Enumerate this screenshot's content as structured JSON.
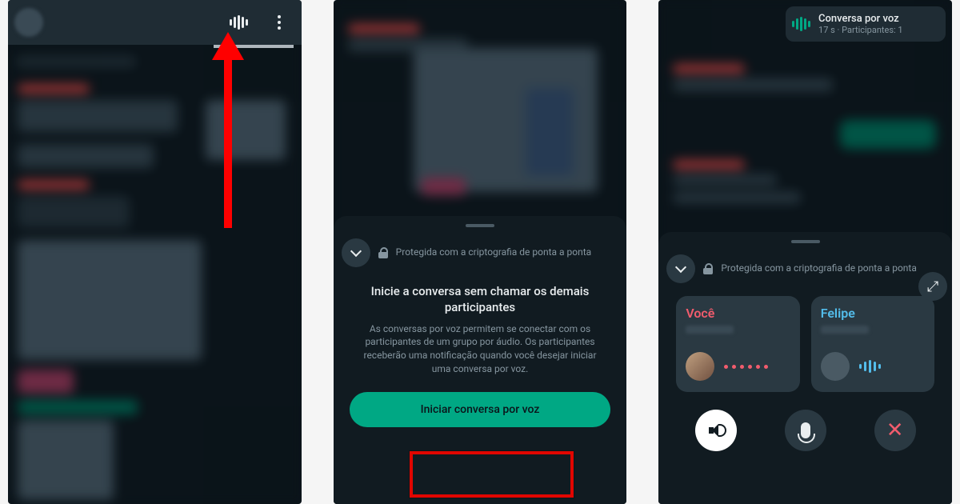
{
  "screen1": {},
  "screen2": {
    "encryption_text": "Protegida com a criptografia de ponta a ponta",
    "heading": "Inicie a conversa sem chamar os demais participantes",
    "description": "As conversas por voz permitem se conectar com os participantes de um grupo por áudio. Os participantes receberão uma notificação quando você desejar iniciar uma conversa por voz.",
    "button_label": "Iniciar conversa por voz"
  },
  "screen3": {
    "banner": {
      "title": "Conversa por voz",
      "subtitle": "17 s · Participantes: 1"
    },
    "encryption_text": "Protegida com a criptografia de ponta a ponta",
    "participants": {
      "you_label": "Você",
      "other_label": "Felipe"
    }
  }
}
